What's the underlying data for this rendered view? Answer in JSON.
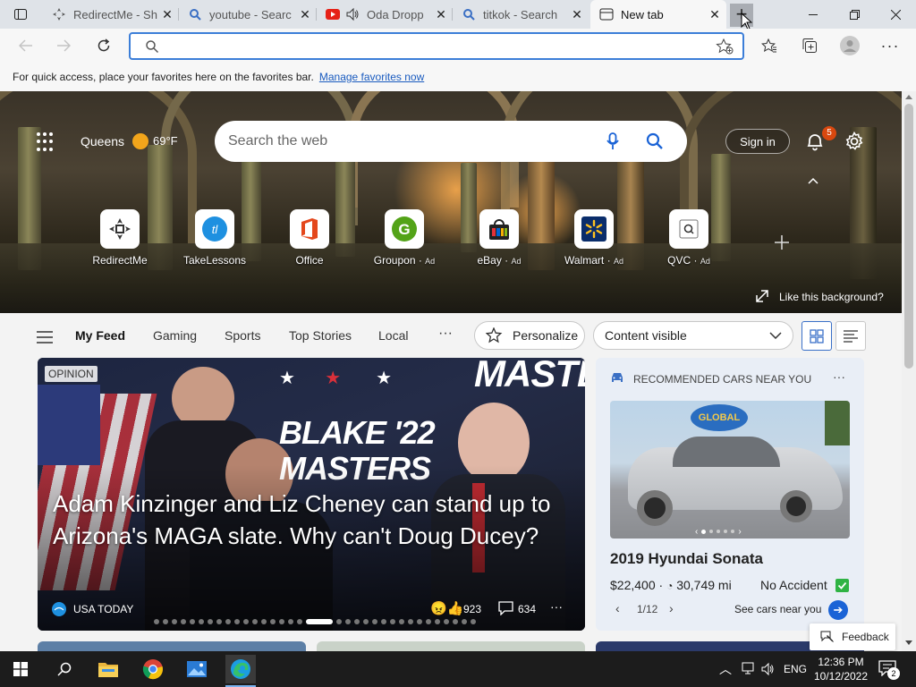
{
  "tabs": [
    {
      "title": "RedirectMe - Sh",
      "icon": "redirectme-favicon"
    },
    {
      "title": "youtube - Searc",
      "icon": "search-favicon"
    },
    {
      "title": "Oda Dropp",
      "icon": "youtube-favicon"
    },
    {
      "title": "titkok - Search",
      "icon": "search-favicon"
    },
    {
      "title": "New tab",
      "icon": "newtab-favicon",
      "active": true
    }
  ],
  "new_tab_label": "+",
  "address": {
    "value": "",
    "placeholder": ""
  },
  "favorites_bar": {
    "text": "For quick access, place your favorites here on the favorites bar.",
    "link": "Manage favorites now"
  },
  "hero": {
    "location": "Queens",
    "temperature": "69°F",
    "search_placeholder": "Search the web",
    "sign_in": "Sign in",
    "notification_count": "5",
    "like_background": "Like this background?"
  },
  "quick_links": [
    {
      "label": "RedirectMe",
      "ad": ""
    },
    {
      "label": "TakeLessons",
      "ad": ""
    },
    {
      "label": "Office",
      "ad": ""
    },
    {
      "label": "Groupon",
      "ad": "Ad"
    },
    {
      "label": "eBay",
      "ad": "Ad"
    },
    {
      "label": "Walmart",
      "ad": "Ad"
    },
    {
      "label": "QVC",
      "ad": "Ad"
    }
  ],
  "feed_nav": {
    "items": [
      "My Feed",
      "Gaming",
      "Sports",
      "Top Stories",
      "Local"
    ],
    "more": "···",
    "personalize": "Personalize",
    "content_visible": "Content visible"
  },
  "main_story": {
    "badge": "OPINION",
    "headline": "Adam Kinzinger and Liz Cheney can stand up to Arizona's MAGA slate. Why can't Doug Ducey?",
    "source": "USA TODAY",
    "reactions": "923",
    "comments": "634",
    "sign_text_1": "BLAKE '22",
    "sign_text_2": "MASTERS",
    "bg_text": "MASTER"
  },
  "side_card": {
    "header": "RECOMMENDED CARS NEAR YOU",
    "car_title": "2019 Hyundai Sonata",
    "price": "$22,400",
    "mileage": "30,749 mi",
    "condition": "No Accident",
    "pager": "1/12",
    "cta": "See cars near you",
    "dealer_sign": "GLOBAL"
  },
  "feedback": "Feedback",
  "taskbar": {
    "language": "ENG",
    "time": "12:36 PM",
    "date": "10/12/2022",
    "notifications": "2"
  }
}
